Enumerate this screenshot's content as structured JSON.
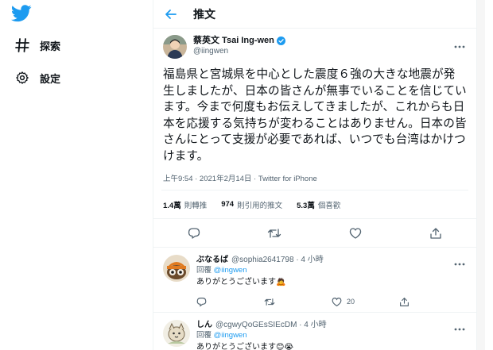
{
  "colors": {
    "brand": "#1d9bf0",
    "text": "#0f1419",
    "muted": "#536471",
    "border": "#eff3f4"
  },
  "nav": {
    "logo_icon": "twitter-bird-icon",
    "explore_label": "探索",
    "settings_label": "設定"
  },
  "header": {
    "title": "推文"
  },
  "tweet": {
    "author_name": "蔡英文 Tsai Ing-wen",
    "author_handle": "@iingwen",
    "text": "福島県と宮城県を中心とした震度６強の大きな地震が発生しましたが、日本の皆さんが無事でいることを信じています。今まで何度もお伝えしてきましたが、これからも日本を応援する気持ちが変わることはありません。日本の皆さんにとって支援が必要であれば、いつでも台湾はかけつけます。",
    "timestamp": "上午9:54 · 2021年2月14日 · ",
    "source": "Twitter for iPhone",
    "stats": {
      "retweets_count": "1.4萬",
      "retweets_label": "則轉推",
      "quotes_count": "974",
      "quotes_label": "則引用的推文",
      "likes_count": "5.3萬",
      "likes_label": "個喜歡"
    }
  },
  "replies": [
    {
      "name": "ぶなるば",
      "handle": "@sophia2641798 · 4 小時",
      "reply_to_prefix": "回覆 ",
      "reply_to": "@iingwen",
      "text": "ありがとうございます🙇",
      "likes": "20"
    },
    {
      "name": "しん",
      "handle": "@cgwyQoGEsSIEcDM · 4 小時",
      "reply_to_prefix": "回覆 ",
      "reply_to": "@iingwen",
      "text": "ありがとうございます😊😭"
    }
  ]
}
